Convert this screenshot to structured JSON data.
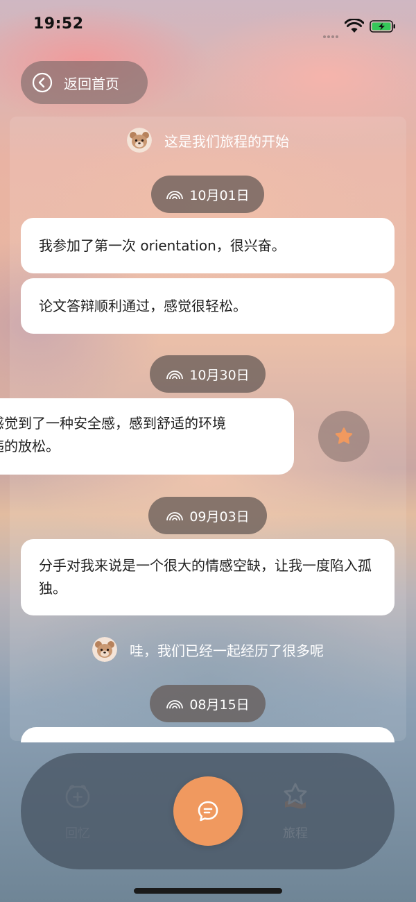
{
  "status_bar": {
    "time": "19:52",
    "wifi_icon": "wifi-icon",
    "battery_icon": "battery-charging-icon",
    "battery_color": "#35c759"
  },
  "nav": {
    "back_label": "返回首页",
    "back_icon": "arrow-left-circle-icon"
  },
  "timeline": {
    "intro_text": "这是我们旅程的开始",
    "groups": [
      {
        "date": "10月01日",
        "entries": [
          "我参加了第一次 orientation，很兴奋。",
          "论文答辩顺利通过，感觉很轻松。"
        ]
      },
      {
        "date": "10月30日",
        "entries": [
          "感觉到了一种安全感，感到舒适的环境\n违的放松。"
        ]
      },
      {
        "date": "09月03日",
        "entries": [
          "分手对我来说是一个很大的情感空缺，让我一度陷入孤独。"
        ]
      }
    ],
    "milestone_text": "哇，我们已经一起经历了很多呢",
    "next_date": "08月15日",
    "favorite_icon": "star-icon",
    "accent_color": "#f0995f"
  },
  "tab_bar": {
    "memory_label": "回忆",
    "memory_icon": "add-memory-icon",
    "chat_icon": "chat-bubble-icon",
    "journey_label": "旅程",
    "journey_icon": "star-journey-icon"
  }
}
